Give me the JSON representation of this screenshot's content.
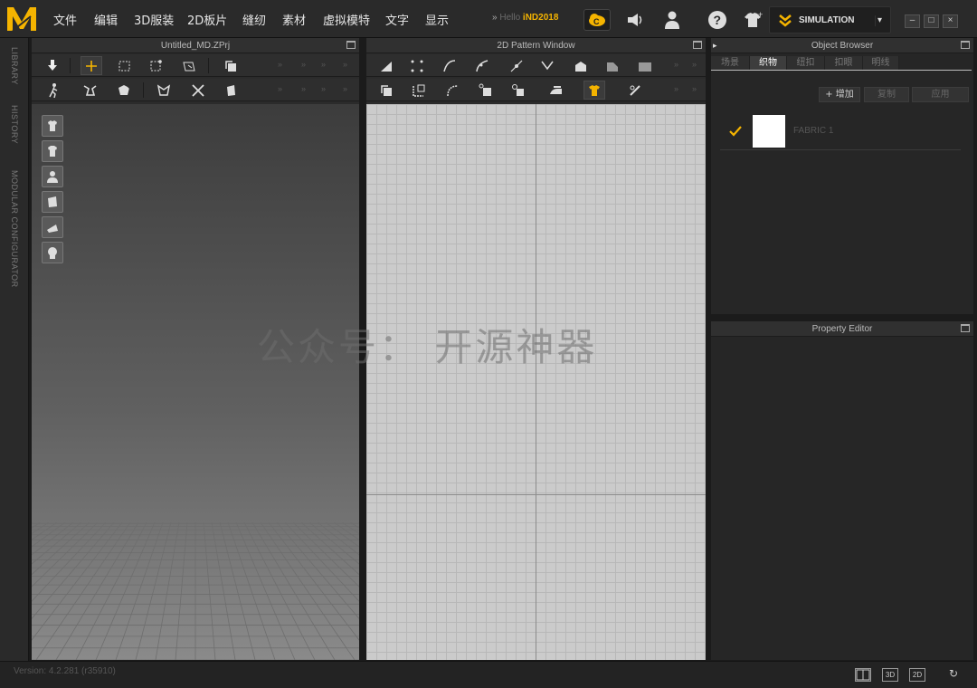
{
  "app": {
    "logo_icon": "marvelous-designer-logo",
    "accent_color": "#f5b400"
  },
  "menu": [
    "文件",
    "编辑",
    "3D服装",
    "2D板片",
    "缝纫",
    "素材",
    "虚拟模特",
    "文字",
    "显示"
  ],
  "greeting": {
    "arrows": "»",
    "prefix": "Hello",
    "username": "iND2018"
  },
  "top_icons": [
    "clo-cloud-icon",
    "speaker-icon",
    "user-icon",
    "help-icon",
    "garment-add-icon"
  ],
  "simulation": {
    "label": "SIMULATION",
    "icon": "double-chevron-icon",
    "dropdown": "▾"
  },
  "window_buttons": [
    "–",
    "□",
    "×"
  ],
  "side_tabs": [
    "LIBRARY",
    "HISTORY",
    "MODULAR CONFIGURATOR"
  ],
  "panels": {
    "view3d_title": "Untitled_MD.ZPrj",
    "view2d_title": "2D Pattern Window",
    "object_browser_title": "Object Browser",
    "property_editor_title": "Property Editor"
  },
  "object_browser": {
    "tabs": [
      "场景",
      "织物",
      "纽扣",
      "扣眼",
      "明线"
    ],
    "active_tab": 1,
    "add_label": "+ 增加",
    "copy_label": "复制",
    "apply_label": "应用",
    "fabric_items": [
      {
        "name": "FABRIC 1",
        "checked": true,
        "swatch_color": "#ffffff"
      }
    ]
  },
  "watermark": "公众号： 开源神器",
  "status": {
    "version": "Version: 4.2.281 (r35910)",
    "view_buttons": [
      "split-view",
      "3D",
      "2D",
      "refresh"
    ]
  }
}
